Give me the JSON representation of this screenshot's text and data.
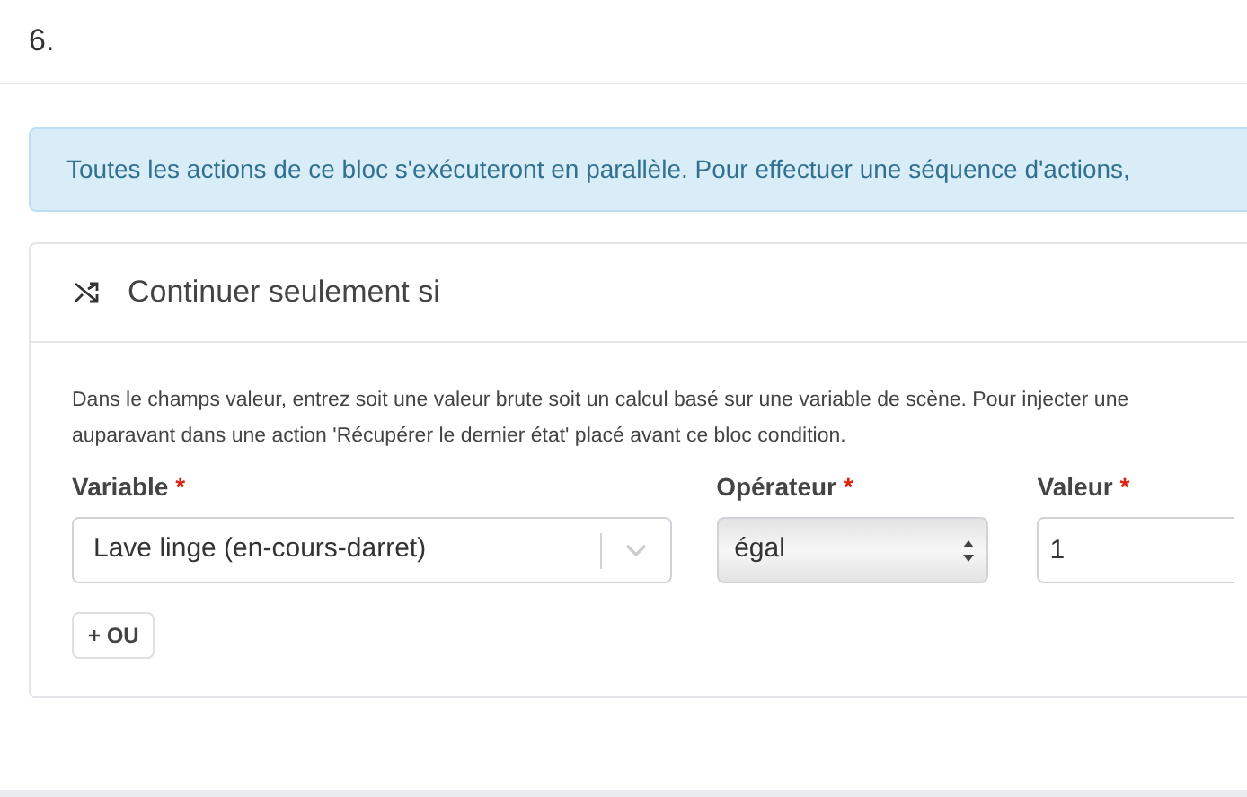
{
  "step": {
    "number": "6."
  },
  "alert": {
    "text": "Toutes les actions de ce bloc s'exécuteront en parallèle. Pour effectuer une séquence d'actions,"
  },
  "card": {
    "title": "Continuer seulement si",
    "help": "Dans le champs valeur, entrez soit une valeur brute soit un calcul basé sur une variable de scène. Pour injecter une",
    "help_2": "auparavant dans une action 'Récupérer le dernier état' placé avant ce bloc condition.",
    "fields": [
      {
        "kind": "combobox",
        "label": "Variable",
        "required": "*",
        "value": "Lave linge (en-cours-darret)"
      },
      {
        "kind": "select",
        "label": "Opérateur",
        "required": "*",
        "value": "égal"
      },
      {
        "kind": "input",
        "label": "Valeur",
        "required": "*",
        "value": "1"
      }
    ],
    "add_button": "+ OU"
  }
}
